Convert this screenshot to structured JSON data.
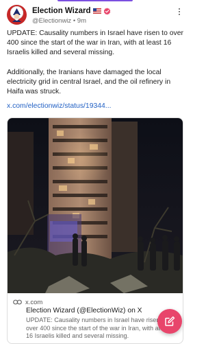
{
  "post": {
    "author_name": "Election Wizard",
    "author_handle": "@Electionwiz",
    "separator": "•",
    "age": "9m",
    "text": "UPDATE: Causality numbers in Israel have risen to over 400 since the start of the war in Iran, with at least 16 Israelis killed and several missing.\n\nAdditionally, the Iranians have damaged the local electricity grid in central Israel, and the oil refinery in Haifa was struck.",
    "link": "x.com/electionwiz/status/19344..."
  },
  "link_card": {
    "domain": "x.com",
    "title": "Election Wizard (@ElectionWiz) on X",
    "description": "UPDATE: Causality numbers in Israel have risen to over 400 since the start of the war in Iran, with at least 16 Israelis killed and several missing."
  },
  "icons": {
    "flag": "us-flag-icon",
    "verified": "verified-badge-icon",
    "more": "more-vertical-icon",
    "link": "link-icon",
    "compose": "compose-icon"
  },
  "colors": {
    "accent": "#7b4fe0",
    "link": "#2160c4",
    "fab": "#e8456b",
    "verified": "#e8456b"
  }
}
